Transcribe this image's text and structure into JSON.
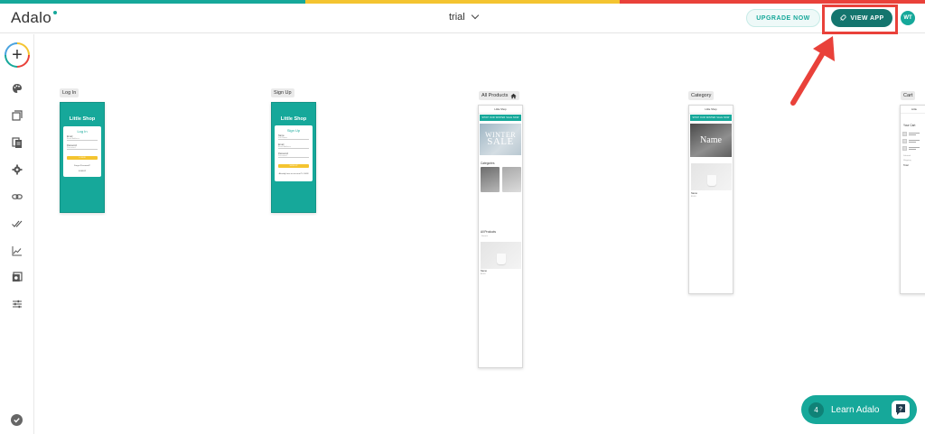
{
  "header": {
    "logo": "Adalo",
    "app_name": "trial",
    "upgrade_label": "UPGRADE NOW",
    "view_app_label": "VIEW APP",
    "avatar_initials": "WT"
  },
  "colors": {
    "brand_teal": "#16a89a",
    "dark_teal": "#14756e",
    "strip_teal": "#16a89a",
    "strip_yellow": "#f4c430",
    "strip_red": "#e9413a",
    "highlight_red": "#e9413a"
  },
  "sidebar": {
    "items": [
      {
        "icon": "add-icon"
      },
      {
        "icon": "palette-icon"
      },
      {
        "icon": "screens-icon"
      },
      {
        "icon": "database-icon"
      },
      {
        "icon": "settings-icon"
      },
      {
        "icon": "link-icon"
      },
      {
        "icon": "double-check-icon"
      },
      {
        "icon": "analytics-icon"
      },
      {
        "icon": "publish-icon"
      },
      {
        "icon": "sliders-icon"
      },
      {
        "icon": "check-circle-icon"
      }
    ]
  },
  "screens": {
    "login": {
      "label": "Log In",
      "shop_title": "Little Shop",
      "card_title": "Log In",
      "email_label": "Email",
      "email_placeholder": "Email Address",
      "password_label": "Password",
      "password_placeholder": "Password",
      "button": "LOGIN",
      "forgot": "Forgot Password?",
      "signup_link": "SIGNUP"
    },
    "signup": {
      "label": "Sign Up",
      "shop_title": "Little Shop",
      "card_title": "Sign Up",
      "name_label": "Name",
      "name_placeholder": "Full Name",
      "email_label": "Email",
      "email_placeholder": "Email Address",
      "password_label": "Password",
      "password_placeholder": "Password",
      "button": "SIGN UP",
      "login_link": "Already have an account? LOGIN"
    },
    "all_products": {
      "label": "All Products",
      "topbar": "Little Shop",
      "banner": "SHOP OUR WINTER SALE NOW",
      "hero_line1": "WINTER",
      "hero_line2": "SALE",
      "categories_label": "Categories",
      "all_products_label": "All Products",
      "search_placeholder": "Search",
      "product_name": "Name",
      "product_price": "$0.00"
    },
    "category": {
      "label": "Category",
      "topbar": "Little Shop",
      "banner": "SHOP OUR WINTER SALE NOW",
      "hero": "Name",
      "product_name": "Name",
      "product_price": "$0.00"
    },
    "cart": {
      "label": "Cart",
      "topbar": "Little",
      "title": "Your Cart",
      "subtotal": "Subtotal",
      "shipping": "Shipping",
      "total": "Total"
    }
  },
  "learn": {
    "count": "4",
    "label": "Learn Adalo"
  }
}
